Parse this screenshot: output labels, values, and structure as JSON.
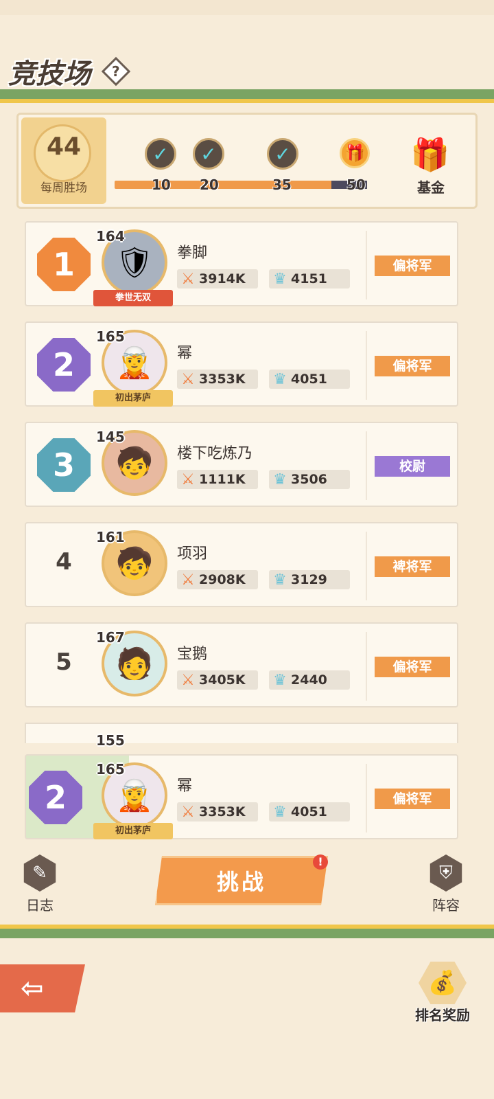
{
  "header": {
    "title": "竞技场",
    "help_icon": "?"
  },
  "weekly": {
    "wins": "44",
    "wins_label": "每周胜场",
    "milestones": [
      "10",
      "20",
      "35",
      "50"
    ],
    "fund_label": "基金",
    "progress_fraction": 0.88
  },
  "ranking": [
    {
      "rank": "1",
      "level": "164",
      "name": "拳脚",
      "title_tag": "拳世无双",
      "power": "3914K",
      "crowns": "4151",
      "rank_tag": "偏将军",
      "rank_tag_color": "#f09a4a",
      "badge_color": "#f08a3e"
    },
    {
      "rank": "2",
      "level": "165",
      "name": "幂",
      "title_tag": "初出茅庐",
      "power": "3353K",
      "crowns": "4051",
      "rank_tag": "偏将军",
      "rank_tag_color": "#f09a4a",
      "badge_color": "#8a6ac8"
    },
    {
      "rank": "3",
      "level": "145",
      "name": "楼下吃炼乃",
      "power": "1111K",
      "crowns": "3506",
      "rank_tag": "校尉",
      "rank_tag_color": "#9a78d4",
      "badge_color": "#5aa6b8"
    },
    {
      "rank": "4",
      "level": "161",
      "name": "项羽",
      "power": "2908K",
      "crowns": "3129",
      "rank_tag": "裨将军",
      "rank_tag_color": "#f09a4a"
    },
    {
      "rank": "5",
      "level": "167",
      "name": "宝鹅",
      "power": "3405K",
      "crowns": "2440",
      "rank_tag": "偏将军",
      "rank_tag_color": "#f09a4a"
    }
  ],
  "partial_row_level": "155",
  "me": {
    "rank": "2",
    "level": "165",
    "name": "幂",
    "title_tag": "初出茅庐",
    "power": "3353K",
    "crowns": "4051",
    "rank_tag": "偏将军"
  },
  "actions": {
    "log_label": "日志",
    "challenge_label": "挑战",
    "challenge_alert": "!",
    "lineup_label": "阵容",
    "reward_label": "排名奖励"
  },
  "colors": {
    "accent_orange": "#f39a4c",
    "stripe_green": "#7aa463",
    "stripe_yellow": "#f0c64a"
  }
}
